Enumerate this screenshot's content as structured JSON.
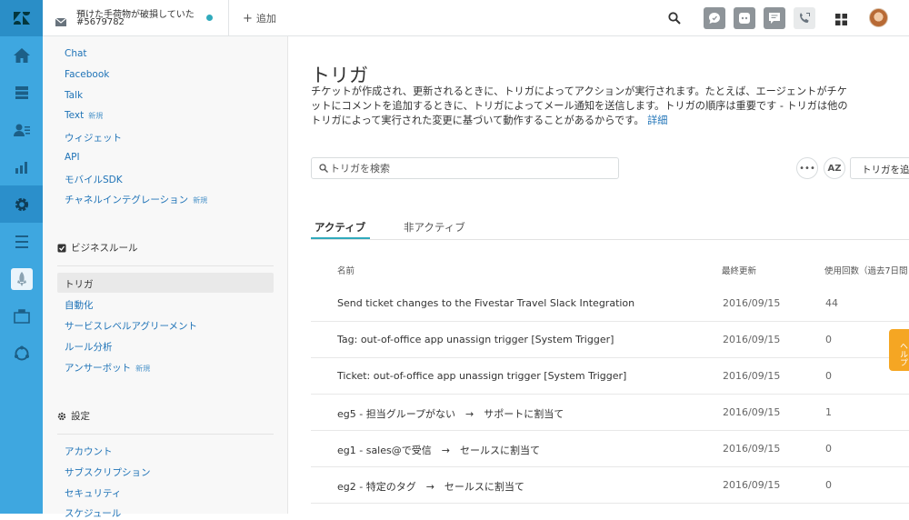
{
  "topbar": {
    "ticket_title": "預けた手荷物が破損していた",
    "ticket_id": "#5679782",
    "add_label": "追加"
  },
  "sidebar": {
    "channels": [
      {
        "label": "Chat",
        "badge": ""
      },
      {
        "label": "Facebook",
        "badge": ""
      },
      {
        "label": "Talk",
        "badge": ""
      },
      {
        "label": "Text",
        "badge": "新規"
      },
      {
        "label": "ウィジェット",
        "badge": ""
      },
      {
        "label": "API",
        "badge": ""
      },
      {
        "label": "モバイルSDK",
        "badge": ""
      },
      {
        "label": "チャネルインテグレーション",
        "badge": "新規"
      }
    ],
    "business_rules_heading": "ビジネスルール",
    "business_rules": [
      {
        "label": "トリガ",
        "badge": ""
      },
      {
        "label": "自動化",
        "badge": ""
      },
      {
        "label": "サービスレベルアグリーメント",
        "badge": ""
      },
      {
        "label": "ルール分析",
        "badge": ""
      },
      {
        "label": "アンサーボット",
        "badge": "新規"
      }
    ],
    "settings_heading": "設定",
    "settings": [
      {
        "label": "アカウント"
      },
      {
        "label": "サブスクリプション"
      },
      {
        "label": "セキュリティ"
      },
      {
        "label": "スケジュール"
      }
    ]
  },
  "main": {
    "title": "トリガ",
    "description": "チケットが作成され、更新されるときに、トリガによってアクションが実行されます。たとえば、エージェントがチケットにコメントを追加するときに、トリガによってメール通知を送信します。トリガの順序は重要です - トリガは他のトリガによって実行された変更に基づいて動作することがあるからです。",
    "details_link": "詳細",
    "search_placeholder": "トリガを検索",
    "more_label": "•••",
    "sort_label": "AZ",
    "add_trigger_label": "トリガを追加",
    "tabs": [
      {
        "label": "アクティブ",
        "active": true
      },
      {
        "label": "非アクティブ",
        "active": false
      }
    ],
    "columns": [
      "名前",
      "最終更新",
      "使用回数（過去7日間"
    ],
    "rows": [
      {
        "name": "Send ticket changes to the Fivestar Travel Slack Integration",
        "updated": "2016/09/15",
        "usage": "44"
      },
      {
        "name": "Tag: out-of-office app unassign trigger [System Trigger]",
        "updated": "2016/09/15",
        "usage": "0"
      },
      {
        "name": "Ticket: out-of-office app unassign trigger [System Trigger]",
        "updated": "2016/09/15",
        "usage": "0"
      },
      {
        "name": "eg5 - 担当グループがない　→　サポートに割当て",
        "updated": "2016/09/15",
        "usage": "1"
      },
      {
        "name": "eg1 - sales@で受信　→　セールスに割当て",
        "updated": "2016/09/15",
        "usage": "0"
      },
      {
        "name": "eg2 - 特定のタグ　→　セールスに割当て",
        "updated": "2016/09/15",
        "usage": "0"
      }
    ]
  },
  "help_tab_label": "ヘルプ",
  "colors": {
    "rail": "#3ea7e0",
    "rail_active": "#2b8fcb",
    "link": "#1f73b7",
    "tab_accent": "#30aabc",
    "help": "#f5a623"
  }
}
